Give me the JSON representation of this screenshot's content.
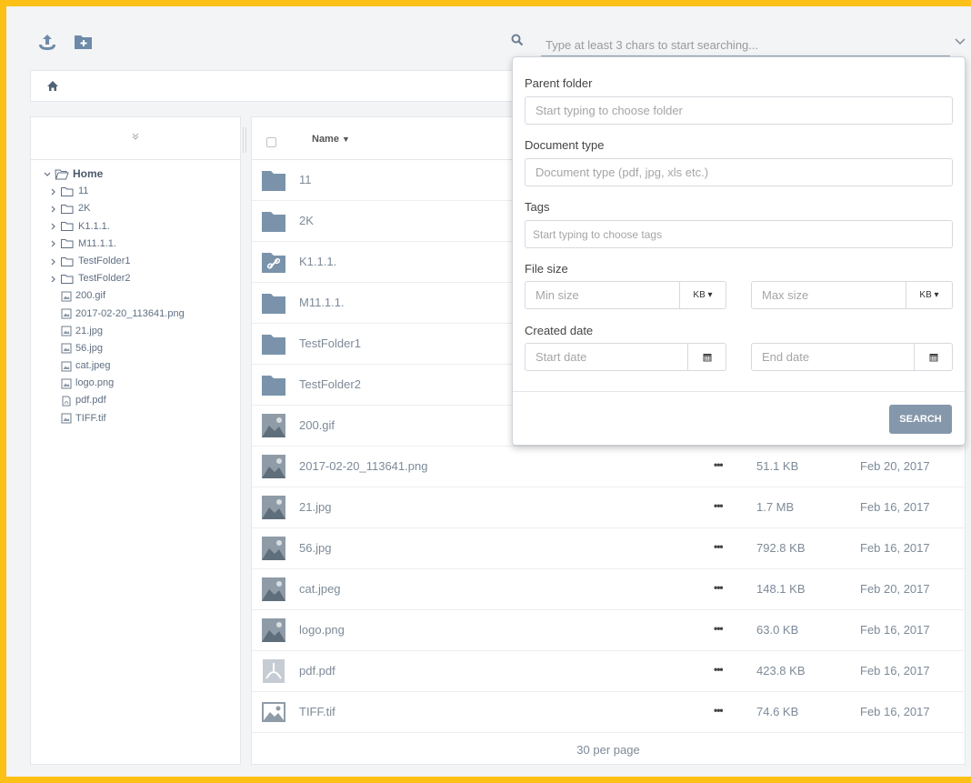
{
  "toolbar": {
    "upload_icon": "upload-icon",
    "new_folder_icon": "new-folder-icon",
    "search_placeholder": "Type at least 3 chars to start searching..."
  },
  "breadcrumb": {
    "home_icon": "home-icon"
  },
  "tree": {
    "root": "Home",
    "folders": [
      "11",
      "2K",
      "K1.1.1.",
      "M11.1.1.",
      "TestFolder1",
      "TestFolder2"
    ],
    "files": [
      "200.gif",
      "2017-02-20_113641.png",
      "21.jpg",
      "56.jpg",
      "cat.jpeg",
      "logo.png",
      "pdf.pdf",
      "TIFF.tif"
    ]
  },
  "list": {
    "name_header": "Name",
    "rows": [
      {
        "name": "11",
        "type": "folder",
        "size": "",
        "date": ""
      },
      {
        "name": "2K",
        "type": "folder",
        "size": "",
        "date": ""
      },
      {
        "name": "K1.1.1.",
        "type": "link-folder",
        "size": "",
        "date": ""
      },
      {
        "name": "M11.1.1.",
        "type": "folder",
        "size": "",
        "date": ""
      },
      {
        "name": "TestFolder1",
        "type": "folder",
        "size": "",
        "date": ""
      },
      {
        "name": "TestFolder2",
        "type": "folder",
        "size": "",
        "date": ""
      },
      {
        "name": "200.gif",
        "type": "image",
        "size": "",
        "date": ""
      },
      {
        "name": "2017-02-20_113641.png",
        "type": "image",
        "dots": "•••",
        "size": "51.1 KB",
        "date": "Feb 20, 2017"
      },
      {
        "name": "21.jpg",
        "type": "image",
        "dots": "•••",
        "size": "1.7 MB",
        "date": "Feb 16, 2017"
      },
      {
        "name": "56.jpg",
        "type": "image",
        "dots": "•••",
        "size": "792.8 KB",
        "date": "Feb 16, 2017"
      },
      {
        "name": "cat.jpeg",
        "type": "image",
        "dots": "•••",
        "size": "148.1 KB",
        "date": "Feb 20, 2017"
      },
      {
        "name": "logo.png",
        "type": "image",
        "dots": "•••",
        "size": "63.0 KB",
        "date": "Feb 16, 2017"
      },
      {
        "name": "pdf.pdf",
        "type": "pdf",
        "dots": "•••",
        "size": "423.8 KB",
        "date": "Feb 16, 2017"
      },
      {
        "name": "TIFF.tif",
        "type": "tif",
        "dots": "•••",
        "size": "74.6 KB",
        "date": "Feb 16, 2017"
      }
    ],
    "per_page": "30 per page"
  },
  "search_panel": {
    "parent_folder_label": "Parent folder",
    "parent_folder_placeholder": "Start typing to choose folder",
    "doc_type_label": "Document type",
    "doc_type_placeholder": "Document type (pdf, jpg, xls etc.)",
    "tags_label": "Tags",
    "tags_placeholder": "Start typing to choose tags",
    "file_size_label": "File size",
    "min_size_placeholder": "Min size",
    "max_size_placeholder": "Max size",
    "size_unit": "KB",
    "created_date_label": "Created date",
    "start_date_placeholder": "Start date",
    "end_date_placeholder": "End date",
    "search_button": "SEARCH"
  },
  "colors": {
    "frame": "#fcc016",
    "folder": "#7a93ab",
    "button": "#8597ab"
  }
}
